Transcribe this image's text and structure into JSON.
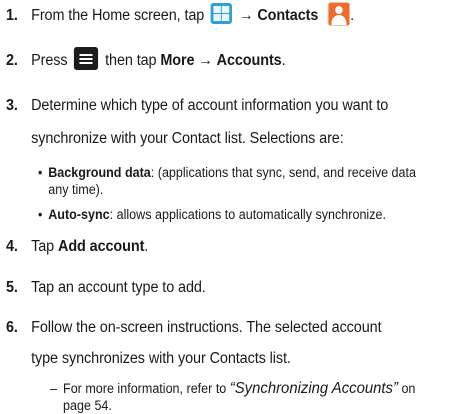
{
  "steps": [
    {
      "number": "1.",
      "text_prefix": "From the Home screen, tap",
      "arrow": "→",
      "target": "Contacts",
      "icons": [
        "apps-grid-icon",
        "contacts-icon"
      ]
    },
    {
      "number": "2.",
      "text_prefix": "Press",
      "text_mid": "then tap",
      "menu_path_1": "More",
      "arrow": "→",
      "menu_path_2": "Accounts",
      "text_suffix": ".",
      "icons": [
        "menu-key-icon"
      ]
    },
    {
      "number": "3.",
      "line1": "Determine which type of account information you want to",
      "line2": "synchronize with your Contact list. Selections are:"
    },
    {
      "number": "4.",
      "text_prefix": "Tap",
      "target": "Add account",
      "text_suffix": "."
    },
    {
      "number": "5.",
      "text": "Tap an account type to add."
    },
    {
      "number": "6.",
      "line1": "Follow the on-screen instructions. The selected account",
      "line2": "type synchronizes with your Contacts list."
    }
  ],
  "bullets": [
    {
      "symbol": "•",
      "term": "Background data",
      "line1": ": (applications that sync, send, and receive data",
      "line2": "any time)."
    },
    {
      "symbol": "•",
      "term": "Auto-sync",
      "line1": ": allows applications to automatically synchronize."
    }
  ],
  "note": {
    "symbol": "–",
    "prefix": "For more information, refer to ",
    "xref": "“Synchronizing Accounts”",
    "suffix": " on",
    "line2": "page 54."
  }
}
